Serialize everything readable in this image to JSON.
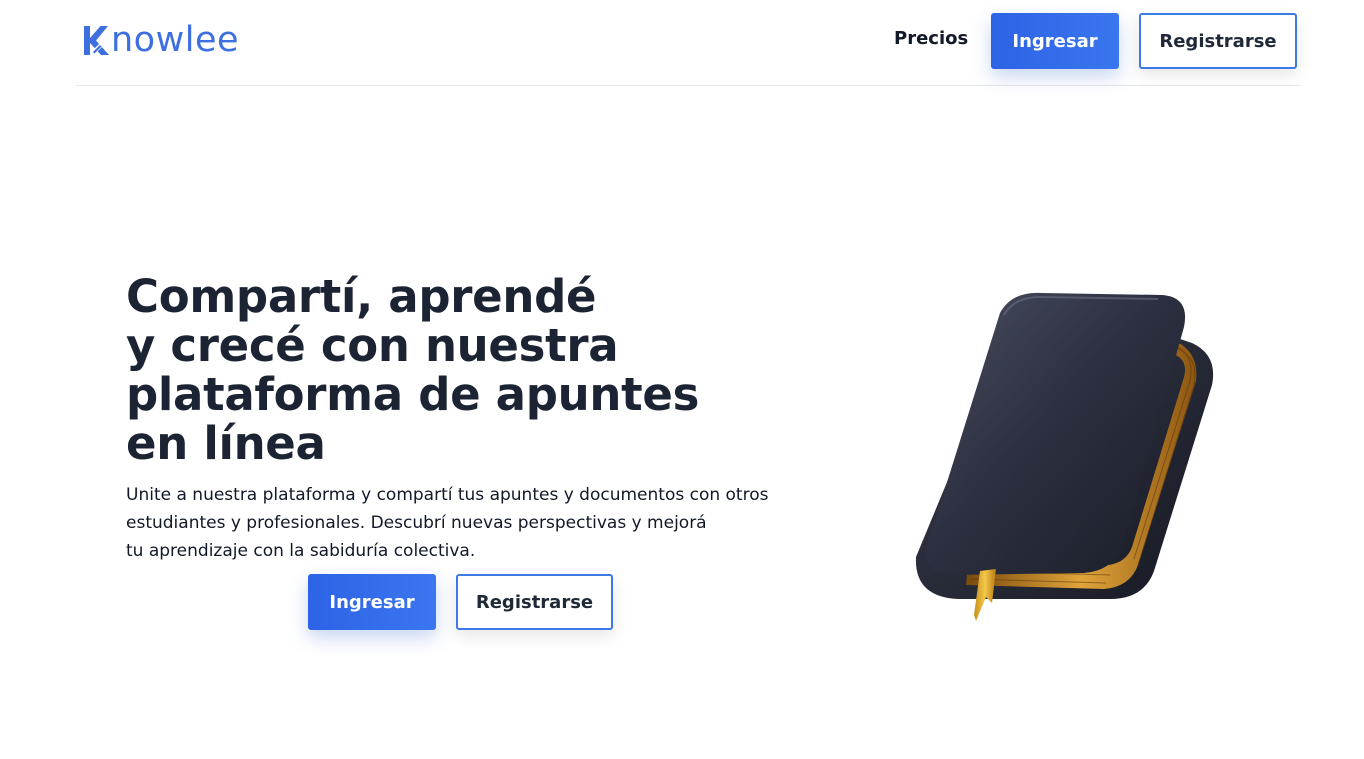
{
  "header": {
    "logo_text": "nowlee",
    "logo_letter": "K",
    "nav": {
      "pricing": "Precios"
    },
    "login_label": "Ingresar",
    "register_label": "Registrarse"
  },
  "hero": {
    "title_lines": [
      "Compartí, aprendé",
      "y crecé con nuestra",
      "plataforma de apuntes",
      "en línea"
    ],
    "description_lines": [
      "Unite a nuestra plataforma y compartí tus apuntes y documentos con otros",
      "estudiantes y profesionales. Descubrí nuevas perspectivas y mejorá",
      "tu aprendizaje con la sabiduría colectiva."
    ],
    "login_label": "Ingresar",
    "register_label": "Registrarse",
    "illustration": "book-icon"
  },
  "colors": {
    "brand": "#3d6fe0",
    "primary_button": "#2d63e6",
    "outline_border": "#3e7ae6",
    "heading": "#1c2434"
  }
}
